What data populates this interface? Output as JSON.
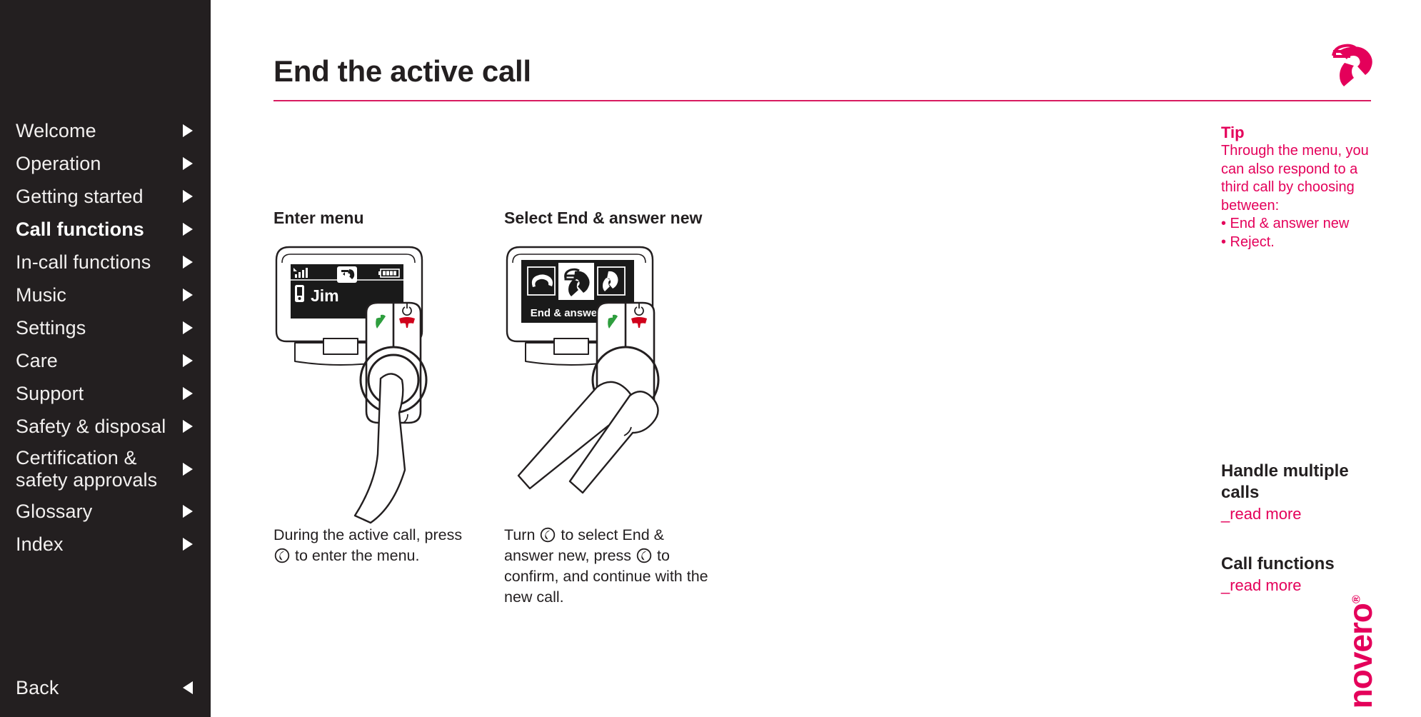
{
  "colors": {
    "accent_pink": "#e4005a",
    "rule_pink": "#d81b60",
    "sidebar_bg": "#231f20",
    "text_dark": "#231f20",
    "button_green": "#2e9e3e",
    "button_red": "#d0021b"
  },
  "sidebar": {
    "items": [
      {
        "label": "Welcome",
        "active": false
      },
      {
        "label": "Operation",
        "active": false
      },
      {
        "label": "Getting started",
        "active": false
      },
      {
        "label": "Call functions",
        "active": true
      },
      {
        "label": "In-call functions",
        "active": false
      },
      {
        "label": "Music",
        "active": false
      },
      {
        "label": "Settings",
        "active": false
      },
      {
        "label": "Care",
        "active": false
      },
      {
        "label": "Support",
        "active": false
      },
      {
        "label": "Safety & disposal",
        "active": false
      },
      {
        "label": "Certification &\nsafety approvals",
        "active": false
      },
      {
        "label": "Glossary",
        "active": false
      },
      {
        "label": "Index",
        "active": false
      }
    ],
    "back_label": "Back"
  },
  "header": {
    "title": "End the active call",
    "icon": "phone-handset-icon"
  },
  "steps": [
    {
      "heading": "Enter menu",
      "caption_before": "During the active call, press ",
      "caption_after": " to enter the menu.",
      "device_screen": {
        "contact_name": "Jim",
        "status_icons": [
          "signal-bars-icon",
          "active-call-icon",
          "battery-icon"
        ]
      }
    },
    {
      "heading": "Select End & answer new",
      "caption_part1": "Turn ",
      "caption_part2": " to select End & answer new, press ",
      "caption_part3": " to confirm, and continue with the new call.",
      "device_screen": {
        "menu_label": "End & answer new",
        "menu_icons": [
          "end-call-icon",
          "end-and-answer-new-icon",
          "answer-call-icon"
        ],
        "selected_index": 1
      }
    }
  ],
  "tip": {
    "title": "Tip",
    "body": "Through the menu, you can also respond to a third call by choosing between:\n• End & answer new\n• Reject."
  },
  "related": [
    {
      "title": "Handle multiple calls",
      "link": "_read more"
    },
    {
      "title": "Call functions",
      "link": "_read more"
    }
  ],
  "brand": {
    "name": "novero",
    "mark": "®"
  }
}
